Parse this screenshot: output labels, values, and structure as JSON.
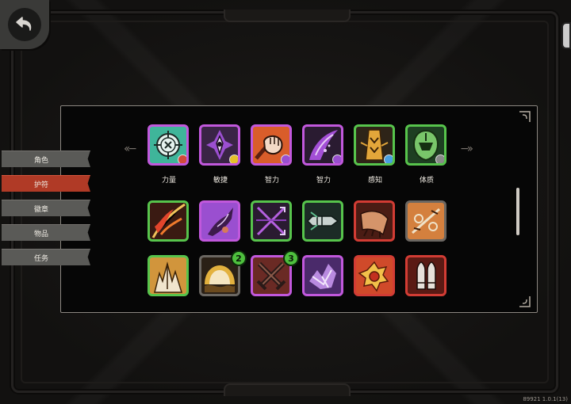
{
  "sidebar": {
    "tabs": [
      {
        "label": "角色",
        "active": false
      },
      {
        "label": "护符",
        "active": true
      },
      {
        "label": "徽章",
        "active": false
      },
      {
        "label": "物品",
        "active": false
      },
      {
        "label": "任务",
        "active": false
      }
    ]
  },
  "attributes": [
    {
      "label": "力量",
      "icon": "crosshair-icon",
      "border": "#c158dc"
    },
    {
      "label": "敏捷",
      "icon": "purple-eye-icon",
      "border": "#c158dc"
    },
    {
      "label": "智力",
      "icon": "fist-icon",
      "border": "#c158dc"
    },
    {
      "label": "智力",
      "icon": "purple-blade-icon",
      "border": "#c158dc"
    },
    {
      "label": "感知",
      "icon": "golden-totem-icon",
      "border": "#57c44c"
    },
    {
      "label": "体质",
      "icon": "green-helmet-icon",
      "border": "#57c44c"
    }
  ],
  "badges": {
    "sun": "2",
    "crossed_swords": "3"
  },
  "version": "89921 1.0.1(13)",
  "colors": {
    "accent_red": "#b03a26",
    "rarity_purple": "#c158dc",
    "rarity_green": "#57c44c",
    "rarity_red": "#d23c34",
    "badge_green": "#4ec03e"
  }
}
